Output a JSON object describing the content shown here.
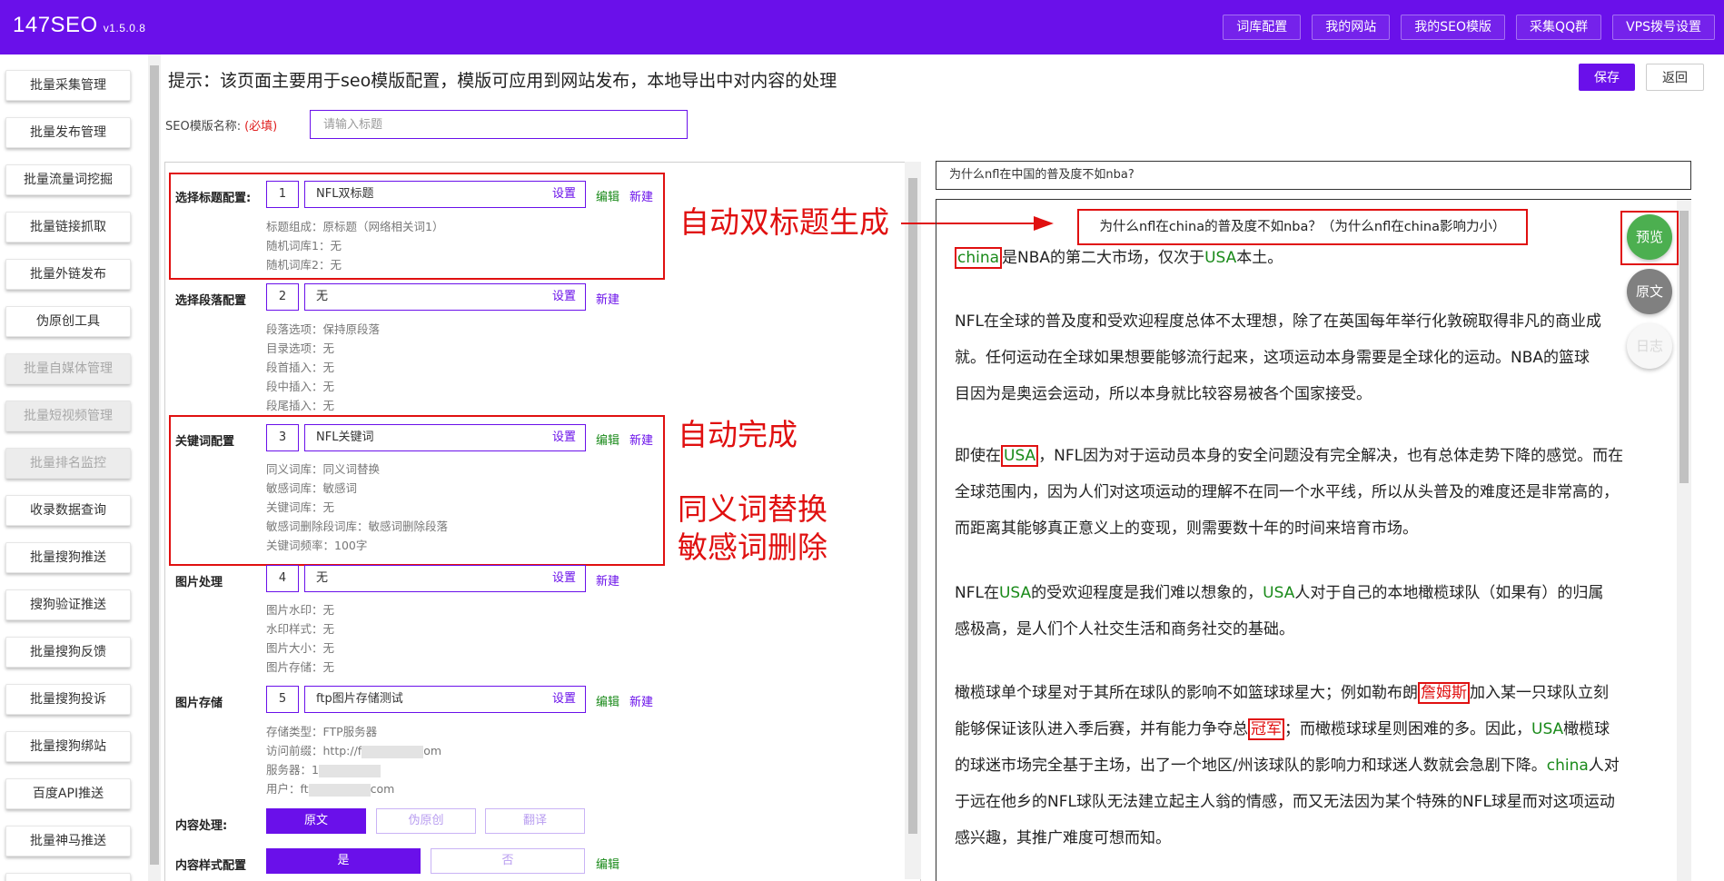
{
  "app": {
    "name": "147SEO",
    "version": "v1.5.0.8"
  },
  "topnav": [
    "词库配置",
    "我的网站",
    "我的SEO模版",
    "采集QQ群",
    "VPS拨号设置"
  ],
  "sidebar": [
    {
      "label": "批量采集管理",
      "disabled": false
    },
    {
      "label": "批量发布管理",
      "disabled": false
    },
    {
      "label": "批量流量词挖掘",
      "disabled": false
    },
    {
      "label": "批量链接抓取",
      "disabled": false
    },
    {
      "label": "批量外链发布",
      "disabled": false
    },
    {
      "label": "伪原创工具",
      "disabled": false
    },
    {
      "label": "批量自媒体管理",
      "disabled": true
    },
    {
      "label": "批量短视频管理",
      "disabled": true
    },
    {
      "label": "批量排名监控",
      "disabled": true
    },
    {
      "label": "收录数据查询",
      "disabled": false
    },
    {
      "label": "批量搜狗推送",
      "disabled": false
    },
    {
      "label": "搜狗验证推送",
      "disabled": false
    },
    {
      "label": "批量搜狗反馈",
      "disabled": false
    },
    {
      "label": "批量搜狗投诉",
      "disabled": false
    },
    {
      "label": "批量搜狗绑站",
      "disabled": false
    },
    {
      "label": "百度API推送",
      "disabled": false
    },
    {
      "label": "批量神马推送",
      "disabled": false
    }
  ],
  "header": {
    "hint": "提示：该页面主要用于seo模版配置，模版可应用到网站发布，本地导出中对内容的处理",
    "save": "保存",
    "back": "返回",
    "name_label": "SEO模版名称:",
    "required": "(必填)",
    "name_placeholder": "请输入标题"
  },
  "config": {
    "set": "设置",
    "edit": "编辑",
    "new": "新建",
    "title": {
      "label": "选择标题配置:",
      "num": "1",
      "value": "NFL双标题",
      "details": [
        "标题组成：原标题（网络相关词1）",
        "随机词库1：无",
        "随机词库2：无"
      ]
    },
    "paragraph": {
      "label": "选择段落配置",
      "num": "2",
      "value": "无",
      "details": [
        "段落选项：保持原段落",
        "目录选项：无",
        "段首插入：无",
        "段中插入：无",
        "段尾插入：无"
      ]
    },
    "keyword": {
      "label": "关键词配置",
      "num": "3",
      "value": "NFL关键词",
      "details": [
        "同义词库：同义词替换",
        "敏感词库：敏感词",
        "关键词库：无",
        "敏感词删除段词库：敏感词删除段落",
        "关键词频率：100字"
      ]
    },
    "image": {
      "label": "图片处理",
      "num": "4",
      "value": "无",
      "details": [
        "图片水印：无",
        "水印样式：无",
        "图片大小：无",
        "图片存储：无"
      ]
    },
    "storage": {
      "label": "图片存储",
      "num": "5",
      "value": "ftp图片存储测试",
      "details": [
        "存储类型：FTP服务器",
        "访问前缀：http://f",
        "om",
        "服务器：1",
        "用户：ft",
        "com"
      ]
    },
    "content": {
      "label": "内容处理:",
      "options": [
        "原文",
        "伪原创",
        "翻译"
      ]
    },
    "style": {
      "label": "内容样式配置",
      "options": [
        "是",
        "否"
      ]
    }
  },
  "annotations": {
    "double_title": "自动双标题生成",
    "auto": "自动完成",
    "synonym": "同义词替换",
    "sensitive": "敏感词删除"
  },
  "preview": {
    "title_input": "为什么nfl在中国的普及度不如nba?",
    "title": "为什么nfl在china的普及度不如nba？（为什么nfl在china影响力小）",
    "p1": [
      "china",
      "是NBA的第二大市场，仅次于",
      "USA",
      "本土。"
    ],
    "p2": [
      "NFL在全球的普及度和受欢迎程度总体不太理想，除了在英国每年举行化敦碗取得非凡的商业成",
      "就。任何运动在全球如果想要能够流行起来，这项运动本身需要是全球化的运动。NBA的篮球",
      "目因为是奥运会运动，所以本身就比较容易被各个国家接受。"
    ],
    "p3": [
      "即使在",
      "USA",
      "，NFL因为对于运动员本身的安全问题没有完全解决，也有总体走势下降的感觉。而在",
      "全球范围内，因为人们对这项运动的理解不在同一个水平线，所以从头普及的难度还是非常高的，",
      "而距离其能够真正意义上的变现，则需要数十年的时间来培育市场。"
    ],
    "p4": [
      "NFL在",
      "USA",
      "的受欢迎程度是我们难以想象的，",
      "USA",
      "人对于自己的本地橄榄球队（如果有）的归属",
      "感极高，是人们个人社交生活和商务社交的基础。"
    ],
    "p5": [
      "橄榄球单个球星对于其所在球队的影响不如篮球球星大；例如勒布朗",
      "詹姆斯",
      "加入某一只球队立刻",
      "能够保证该队进入季后赛，并有能力争夺总",
      "冠军",
      "；而橄榄球球星则困难的多。因此，",
      "USA",
      "橄榄球",
      "的球迷市场完全基于主场，出了一个地区/州该球队的影响力和球迷人数就会急剧下降。",
      "china",
      "人对",
      "于远在他乡的NFL球队无法建立起主人翁的情感，而又无法因为某个特殊的NFL球星而对这项运动",
      "感兴趣，其推广难度可想而知。"
    ],
    "fab_preview": "预览",
    "fab_original": "原文",
    "fab_log": "日志"
  },
  "colors": {
    "brand": "#6a10ea",
    "accent_green": "#1a8a1a",
    "annotation_red": "#e01010"
  }
}
